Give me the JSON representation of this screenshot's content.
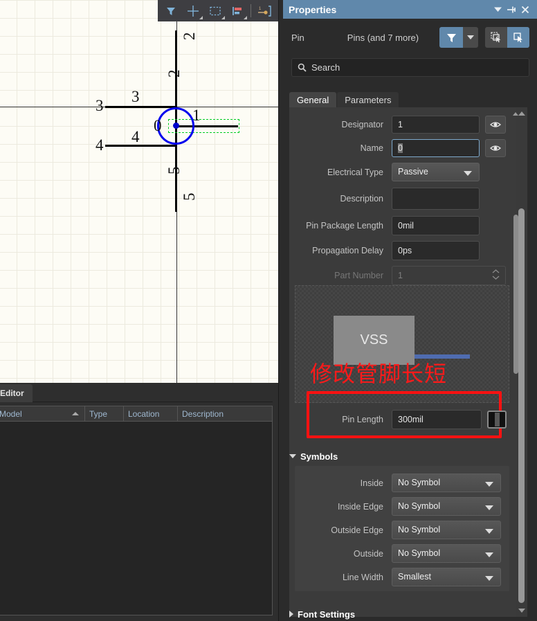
{
  "canvas": {
    "toolbar": [
      {
        "icon": "filter-icon",
        "name": "filter-tool"
      },
      {
        "icon": "crosshair-icon",
        "name": "crosshair-tool"
      },
      {
        "icon": "marquee-select-icon",
        "name": "marquee-select-tool"
      },
      {
        "icon": "align-icon",
        "name": "align-tool"
      },
      {
        "icon": "place-pin-icon",
        "name": "place-pin-tool"
      }
    ],
    "labels": [
      {
        "text": "2",
        "name": "pin-number-2-top",
        "rotated": true
      },
      {
        "text": "2",
        "name": "pin-name-2",
        "rotated": true
      },
      {
        "text": "3",
        "name": "pin-number-3"
      },
      {
        "text": "3",
        "name": "pin-name-3"
      },
      {
        "text": "4",
        "name": "pin-number-4"
      },
      {
        "text": "4",
        "name": "pin-name-4"
      },
      {
        "text": "5",
        "name": "pin-name-5",
        "rotated": true
      },
      {
        "text": "5",
        "name": "pin-number-5",
        "rotated": true
      },
      {
        "text": "1",
        "name": "pin-number-1"
      },
      {
        "text": "0",
        "name": "pin-name-0"
      }
    ]
  },
  "editor": {
    "tab_label": "Editor",
    "columns": [
      "Model",
      "Type",
      "Location",
      "Description"
    ],
    "rows": []
  },
  "properties": {
    "title": "Properties",
    "title_buttons": [
      {
        "name": "panel-dropdown-button",
        "icon": "chevron-down-icon"
      },
      {
        "name": "panel-pin-button",
        "icon": "pin-icon"
      },
      {
        "name": "panel-close-button",
        "icon": "close-icon"
      }
    ],
    "object_kind": "Pin",
    "object_count": "Pins (and 7 more)",
    "filter_button": "filter-icon",
    "select_buttons": [
      "select-all-icon",
      "select-similar-icon"
    ],
    "search": {
      "placeholder": "Search",
      "value": ""
    },
    "tabs": [
      {
        "label": "General",
        "active": true
      },
      {
        "label": "Parameters",
        "active": false
      }
    ],
    "general": {
      "fields": [
        {
          "label": "Designator",
          "value": "1",
          "type": "text",
          "eye": true,
          "name": "designator"
        },
        {
          "label": "Name",
          "value": "0",
          "type": "text",
          "eye": true,
          "focused": true,
          "selected": true,
          "name": "name"
        },
        {
          "label": "Electrical Type",
          "value": "Passive",
          "type": "select",
          "name": "electrical-type"
        },
        {
          "label": "Description",
          "value": "",
          "type": "text",
          "name": "description"
        },
        {
          "label": "Pin Package Length",
          "value": "0mil",
          "type": "text",
          "name": "pin-package-length"
        },
        {
          "label": "Propagation Delay",
          "value": "0ps",
          "type": "text",
          "name": "propagation-delay"
        },
        {
          "label": "Part Number",
          "value": "1",
          "type": "spinner",
          "disabled": true,
          "name": "part-number"
        }
      ]
    },
    "preview": {
      "component_label": "VSS",
      "pin_color": "#4f6cb0"
    },
    "annotation": {
      "text": "修改管脚长短",
      "color": "#ff1a1a"
    },
    "pin_length": {
      "label": "Pin Length",
      "value": "300mil",
      "color_swatch": "#111111",
      "highlight_color": "#ff1111"
    },
    "symbols": {
      "header": "Symbols",
      "expanded": true,
      "fields": [
        {
          "label": "Inside",
          "value": "No Symbol",
          "name": "symbol-inside"
        },
        {
          "label": "Inside Edge",
          "value": "No Symbol",
          "name": "symbol-inside-edge"
        },
        {
          "label": "Outside Edge",
          "value": "No Symbol",
          "name": "symbol-outside-edge"
        },
        {
          "label": "Outside",
          "value": "No Symbol",
          "name": "symbol-outside"
        },
        {
          "label": "Line Width",
          "value": "Smallest",
          "name": "symbol-line-width"
        }
      ]
    },
    "font_settings": {
      "header": "Font Settings",
      "expanded": false
    }
  },
  "theme": {
    "accent": "#6088ab",
    "canvas_bg": "#fdfcf5",
    "panel_bg": "#3b3b3b"
  }
}
